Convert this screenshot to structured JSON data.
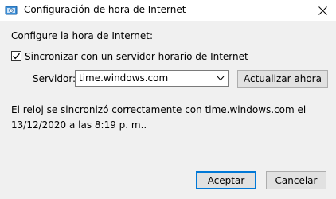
{
  "window": {
    "title": "Configuración de hora de Internet",
    "icons": {
      "app": "internet-time-icon",
      "close": "close-icon"
    }
  },
  "content": {
    "heading": "Configure la hora de Internet:",
    "sync_checkbox": {
      "label": "Sincronizar con un servidor horario de Internet",
      "checked": true
    },
    "server_label": "Servidor:",
    "server_combo": {
      "value": "time.windows.com"
    },
    "update_button": "Actualizar ahora",
    "status_message": "El reloj se sincronizó correctamente con time.windows.com el 13/12/2020 a las 8:19 p. m.."
  },
  "footer": {
    "ok_button": "Aceptar",
    "cancel_button": "Cancelar"
  },
  "colors": {
    "accent": "#0078d7",
    "titlebar_bg": "#ffffff",
    "dialog_bg": "#f0f0f0"
  }
}
